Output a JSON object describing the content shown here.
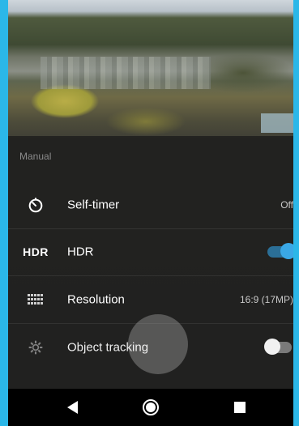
{
  "settings": {
    "section_title": "Manual",
    "items": [
      {
        "label": "Self-timer",
        "value": "Off",
        "icon": "timer-icon"
      },
      {
        "label": "HDR",
        "icon_text": "HDR",
        "icon": "hdr-icon",
        "toggle": true
      },
      {
        "label": "Resolution",
        "value": "16:9 (17MP)",
        "icon": "resolution-grid-icon"
      },
      {
        "label": "Object tracking",
        "icon": "gear-icon",
        "toggle": false
      }
    ]
  },
  "navbar": {
    "buttons": [
      "back-icon",
      "home-icon",
      "recents-icon"
    ]
  },
  "colors": {
    "accent": "#3aa8e6",
    "frame": "#2bb7e8",
    "overlay": "#1c1c1c"
  }
}
